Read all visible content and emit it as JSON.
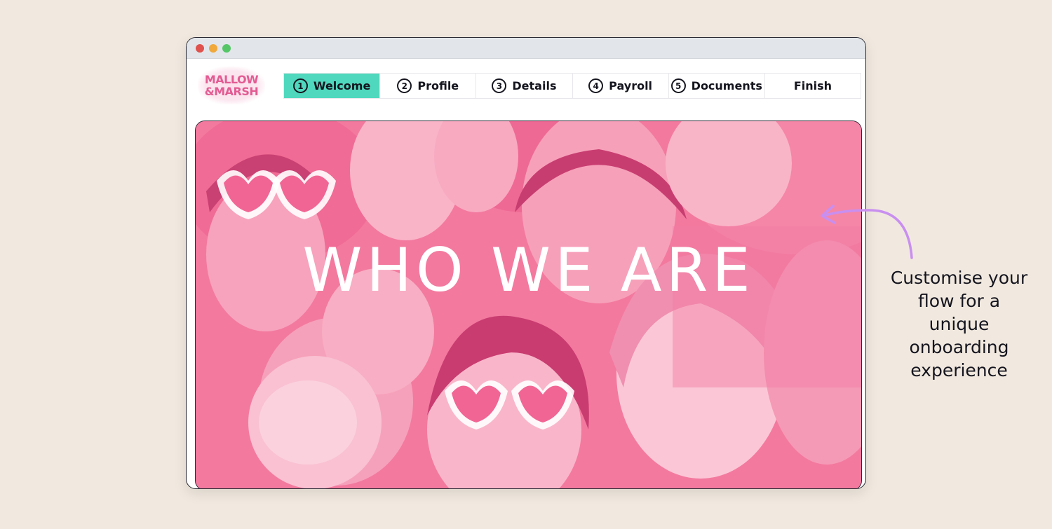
{
  "window": {
    "dot_colors": {
      "close": "#e0524d",
      "minimize": "#f0a93a",
      "maximize": "#55c667"
    }
  },
  "brand": {
    "logo_line1": "MALLOW",
    "logo_line2": "&MARSH",
    "color": "#e25c93"
  },
  "steps": [
    {
      "number": "1",
      "label": "Welcome",
      "active": true
    },
    {
      "number": "2",
      "label": "Profile"
    },
    {
      "number": "3",
      "label": "Details"
    },
    {
      "number": "4",
      "label": "Payroll"
    },
    {
      "number": "5",
      "label": "Documents"
    },
    {
      "number": "",
      "label": "Finish"
    }
  ],
  "hero": {
    "title": "WHO WE ARE",
    "tint": "#f3799f"
  },
  "annotation": {
    "text_lines": [
      "Customise your",
      "flow for a",
      "unique",
      "onboarding",
      "experience"
    ],
    "arrow_color": "#c98ff0"
  },
  "colors": {
    "background": "#f1e9df",
    "active_step": "#4fd8bd"
  }
}
